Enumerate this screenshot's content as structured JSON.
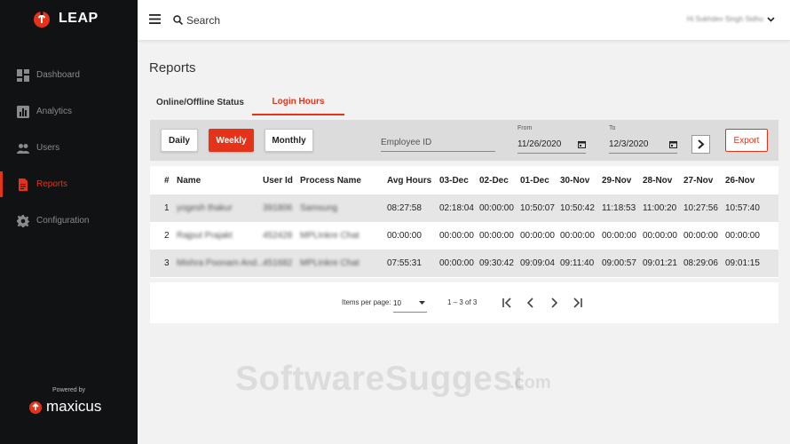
{
  "app": {
    "name": "LEAP",
    "brand_color": "#e5331a",
    "sidebar_bg": "#111214"
  },
  "sidebar": {
    "items": [
      {
        "label": "Dashboard",
        "icon": "dashboard-icon"
      },
      {
        "label": "Analytics",
        "icon": "analytics-icon"
      },
      {
        "label": "Users",
        "icon": "users-icon"
      },
      {
        "label": "Reports",
        "icon": "reports-icon",
        "active": true
      },
      {
        "label": "Configuration",
        "icon": "gear-icon"
      }
    ],
    "powered_by": "Powered by",
    "company": "maxicus"
  },
  "topbar": {
    "search_label": "Search",
    "user_greeting": "Hi Sukhdev Singh Sidhu"
  },
  "page": {
    "title": "Reports"
  },
  "tabs": [
    {
      "label": "Online/Offline Status",
      "active": false
    },
    {
      "label": "Login Hours",
      "active": true
    }
  ],
  "filters": {
    "periods": [
      "Daily",
      "Weekly",
      "Monthly"
    ],
    "selected_period": "Weekly",
    "employee_placeholder": "Employee ID",
    "from_label": "From",
    "from_value": "11/26/2020",
    "to_label": "To",
    "to_value": "12/3/2020",
    "export_label": "Export"
  },
  "table": {
    "headers": [
      "#",
      "Name",
      "User Id",
      "Process Name",
      "Avg Hours",
      "03-Dec",
      "02-Dec",
      "01-Dec",
      "30-Nov",
      "29-Nov",
      "28-Nov",
      "27-Nov",
      "26-Nov"
    ],
    "rows": [
      [
        "1",
        "yogesh thakur",
        "391806",
        "Samsung",
        "08:27:58",
        "02:18:04",
        "00:00:00",
        "10:50:07",
        "10:50:42",
        "11:18:53",
        "11:00:20",
        "10:27:56",
        "10:57:40"
      ],
      [
        "2",
        "Rajput Prajakt",
        "452428",
        "MPLInkre Chat",
        "00:00:00",
        "00:00:00",
        "00:00:00",
        "00:00:00",
        "00:00:00",
        "00:00:00",
        "00:00:00",
        "00:00:00",
        "00:00:00"
      ],
      [
        "3",
        "Mishra Poonam And...",
        "451682",
        "MPLInkre Chat",
        "07:55:31",
        "00:00:00",
        "09:30:42",
        "09:09:04",
        "09:11:40",
        "09:00:57",
        "09:01:21",
        "08:29:06",
        "09:01:15"
      ]
    ]
  },
  "paginator": {
    "items_per_page_label": "Items per page:",
    "items_per_page": "10",
    "range": "1 – 3 of 3"
  },
  "watermark": {
    "text": "SoftwareSuggest",
    "suffix": ".com"
  }
}
